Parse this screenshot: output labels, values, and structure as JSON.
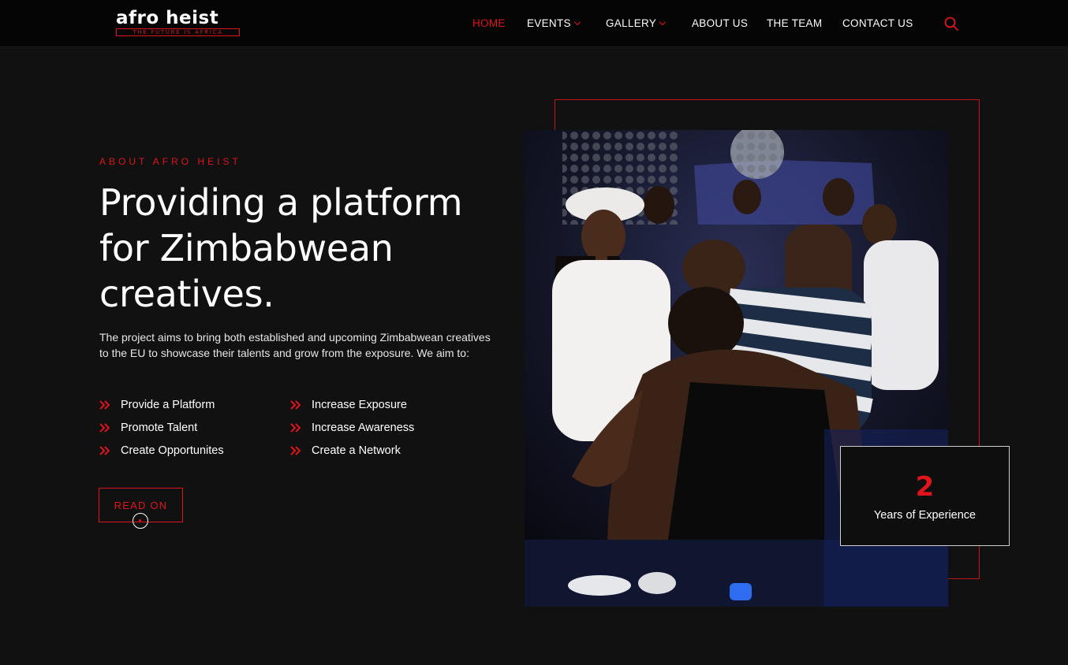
{
  "brand": {
    "name": "afro heist",
    "tagline": "THE FUTURE IS AFRICA",
    "accent_color": "#e0141b"
  },
  "nav": {
    "items": [
      {
        "label": "HOME",
        "active": true
      },
      {
        "label": "EVENTS",
        "has_dropdown": true
      },
      {
        "label": "GALLERY",
        "has_dropdown": true
      },
      {
        "label": "ABOUT US"
      },
      {
        "label": "THE TEAM"
      },
      {
        "label": "CONTACT US"
      }
    ],
    "search_icon": "search-icon"
  },
  "about": {
    "eyebrow": "ABOUT AFRO HEIST",
    "headline_lines": [
      "Providing a platform",
      "for Zimbabwean",
      "creatives."
    ],
    "intro": "The project aims to bring both established and upcoming Zimbabwean creatives to the EU to showcase their talents and grow from the exposure. We aim to:",
    "aims": [
      "Provide a Platform",
      "Increase Exposure",
      "Promote Talent",
      "Increase Awareness",
      "Create Opportunites",
      "Create a Network"
    ],
    "cta_label": "READ ON"
  },
  "stats": {
    "years_value": "2",
    "years_label": "Years of Experience"
  }
}
